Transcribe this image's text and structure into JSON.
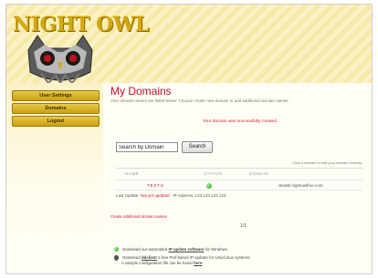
{
  "header": {
    "logo_text": "NIGHT OWL"
  },
  "sidebar": {
    "items": [
      {
        "label": "User Settings"
      },
      {
        "label": "Domains"
      },
      {
        "label": "Logout"
      }
    ]
  },
  "main": {
    "title": "My Domains",
    "description": "Your domain names are listed below. Choose create new domain to add additional domain names.",
    "flash_message": "Your domain was successfully created.",
    "search": {
      "value": "Search by Domain",
      "button_label": "Search"
    },
    "click_hint": "Click a domain to edit your domain records.",
    "table": {
      "headers": {
        "name": "NAME",
        "status": "STATUS",
        "domain": "DOMAIN"
      },
      "rows": [
        {
          "name": "TESTS",
          "status": "active",
          "domain": "stealth.nightowlfree.com"
        }
      ],
      "last_update_label": "Last Update:",
      "last_update_value": "Not yet updated",
      "ip_label": "IP Address:",
      "ip_value": "123.123.123.123"
    },
    "create_link": "Create additional domain names",
    "pager": "1/1",
    "downloads": {
      "line1_pre": "Download our automated",
      "line1_link": "IP update software",
      "line1_post": "for Windows.",
      "line2_pre": "Download",
      "line2_link": "ddclient",
      "line2_post": "a free Perl based IP updater for Unix/Linux systems.",
      "line3_pre": "A sample configuration file can be found",
      "line3_link": "here",
      "line3_post": "."
    }
  }
}
